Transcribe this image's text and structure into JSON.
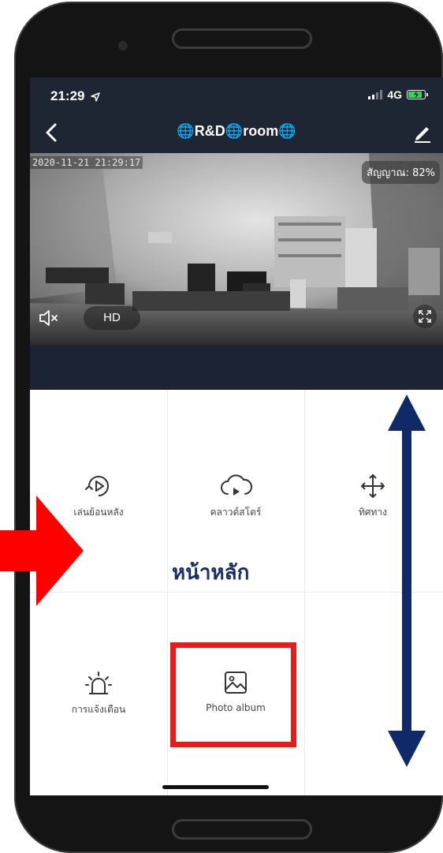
{
  "status": {
    "time": "21:29",
    "network": "4G"
  },
  "nav": {
    "title": "🌐R&D🌐room🌐"
  },
  "video": {
    "timestamp": "2020-11-21  21:29:17",
    "signal_label": "สัญญาณ: 82%",
    "quality_label": "HD"
  },
  "features": [
    {
      "label": "เล่นย้อนหลัง",
      "icon": "playback-icon"
    },
    {
      "label": "คลาวด์สโตร์",
      "icon": "cloud-storage-icon"
    },
    {
      "label": "ทิศทาง",
      "icon": "direction-icon"
    },
    {
      "label": "การแจ้งเตือน",
      "icon": "alarm-icon"
    },
    {
      "label": "Photo album",
      "icon": "photo-album-icon"
    }
  ],
  "annotation": {
    "main_label": "หน้าหลัก"
  },
  "colors": {
    "header_bg": "#1e2533",
    "highlight": "#e81b1b",
    "arrow_red": "#ff0000",
    "scroll_arrow": "#0f2a66",
    "annotation_text": "#1a2d6b"
  }
}
